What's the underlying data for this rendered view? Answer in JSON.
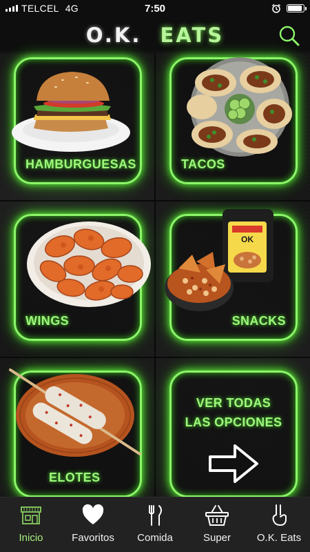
{
  "status_bar": {
    "carrier": "TELCEL",
    "network": "4G",
    "time": "7:50",
    "battery_level": 0.9
  },
  "header": {
    "title_part1": "O.K.",
    "title_part2": "EATS",
    "search_icon": "search-icon"
  },
  "tiles": [
    {
      "label": "HAMBURGUESAS"
    },
    {
      "label": "TACOS"
    },
    {
      "label": "WINGS"
    },
    {
      "label": "SNACKS"
    },
    {
      "label": "ELOTES"
    },
    {
      "label_line1": "VER TODAS",
      "label_line2": "LAS OPCIONES"
    }
  ],
  "snack_bag_text": "OK",
  "nav": [
    {
      "label": "Inicio",
      "icon": "store-icon",
      "active": true
    },
    {
      "label": "Favoritos",
      "icon": "heart-icon"
    },
    {
      "label": "Comida",
      "icon": "utensils-icon"
    },
    {
      "label": "Super",
      "icon": "basket-icon"
    },
    {
      "label": "O.K. Eats",
      "icon": "ok-hand-icon"
    }
  ],
  "colors": {
    "neon_green": "#8cf66a",
    "background": "#181818",
    "nav_active": "#a7f07f"
  }
}
